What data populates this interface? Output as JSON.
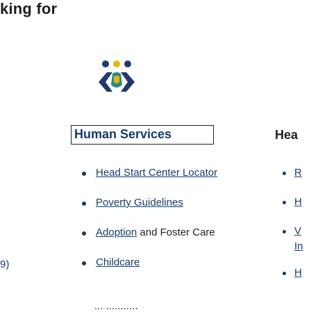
{
  "header": {
    "title": "king for"
  },
  "logo": {
    "name": "community-logo",
    "colors": {
      "navy": "#1f3a6b",
      "gold": "#e8b800",
      "teal": "#2a8a8a"
    }
  },
  "service_select": {
    "selected": "Human Services"
  },
  "links": [
    {
      "label": "Head Start Center Locator"
    },
    {
      "label": "Poverty Guidelines"
    },
    {
      "label_link": "Adoption",
      "label_rest": " and Foster Care"
    },
    {
      "label": "Childcare"
    }
  ],
  "right_column": {
    "heading": "Hea",
    "items": [
      {
        "label": "R"
      },
      {
        "label": "H"
      },
      {
        "label": "V",
        "extra": "In"
      },
      {
        "label": "H"
      }
    ]
  },
  "left_fragment": "9)",
  "bottom_fragment": "... ..........."
}
